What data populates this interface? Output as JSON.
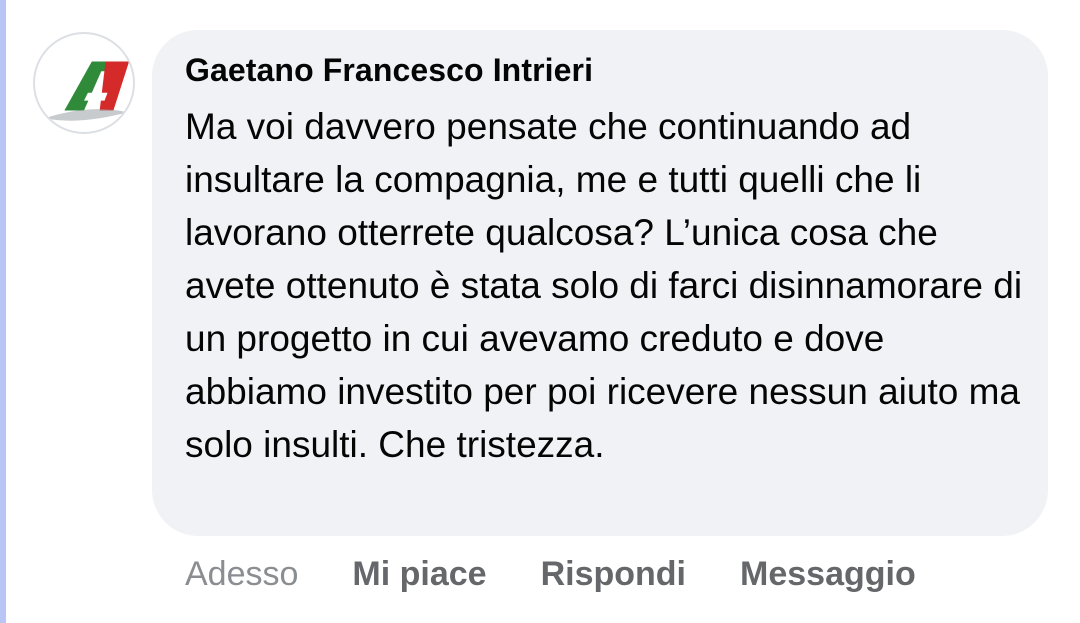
{
  "comment": {
    "author": "Gaetano Francesco Intrieri",
    "text": "Ma voi davvero pensate che continuando ad insultare la compagnia, me e tutti quelli che li lavorano otterrete qualcosa? L’unica cosa che avete ottenuto è stata solo di farci disinnamorare di un progetto in cui avevamo creduto e dove abbiamo investito per poi ricevere nessun aiuto ma solo insulti. Che tristezza.",
    "avatar_icon": "airline-logo-icon",
    "timestamp": "Adesso",
    "actions": {
      "like": "Mi piace",
      "reply": "Rispondi",
      "message": "Messaggio"
    }
  },
  "colors": {
    "bubble_background": "#f0f2f5",
    "author_text": "#050505",
    "action_text": "#65676b",
    "timestamp_text": "#8a8d91",
    "thread_line": "#b9c6f5",
    "logo_green": "#2f8a3a",
    "logo_red": "#d42a2a"
  }
}
